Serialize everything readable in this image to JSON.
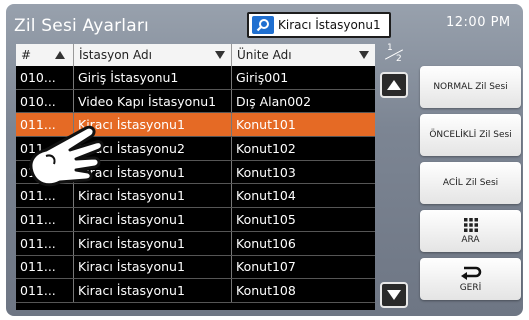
{
  "header": {
    "title": "Zil Sesi Ayarları",
    "search_value": "Kiracı İstasyonu1",
    "clock": "12:00 PM"
  },
  "table": {
    "columns": [
      "#",
      "İstasyon Adı",
      "Ünite Adı"
    ],
    "rows": [
      {
        "num": "010...",
        "station": "Giriş İstasyonu1",
        "unit": "Giriş001"
      },
      {
        "num": "010...",
        "station": "Video Kapı İstasyonu1",
        "unit": "Dış Alan002"
      },
      {
        "num": "011...",
        "station": "Kiracı İstasyonu1",
        "unit": "Konut101"
      },
      {
        "num": "011...",
        "station": "Kiracı İstasyonu2",
        "unit": "Konut102"
      },
      {
        "num": "011...",
        "station": "Kiracı İstasyonu1",
        "unit": "Konut103"
      },
      {
        "num": "011...",
        "station": "Kiracı İstasyonu1",
        "unit": "Konut104"
      },
      {
        "num": "011...",
        "station": "Kiracı İstasyonu1",
        "unit": "Konut105"
      },
      {
        "num": "011...",
        "station": "Kiracı İstasyonu1",
        "unit": "Konut106"
      },
      {
        "num": "011...",
        "station": "Kiracı İstasyonu1",
        "unit": "Konut107"
      },
      {
        "num": "011...",
        "station": "Kiracı İstasyonu1",
        "unit": "Konut108"
      }
    ],
    "selected_index": 2
  },
  "pager": {
    "current": "1",
    "total": "2"
  },
  "actions": {
    "normal": "NORMAL Zil Sesi",
    "priority": "ÖNCELİKLİ Zil Sesi",
    "emergency": "ACİL Zil Sesi",
    "search": "ARA",
    "back": "GERİ"
  },
  "colors": {
    "selected_row": "#e56a25",
    "accent": "#1f6fd0"
  }
}
